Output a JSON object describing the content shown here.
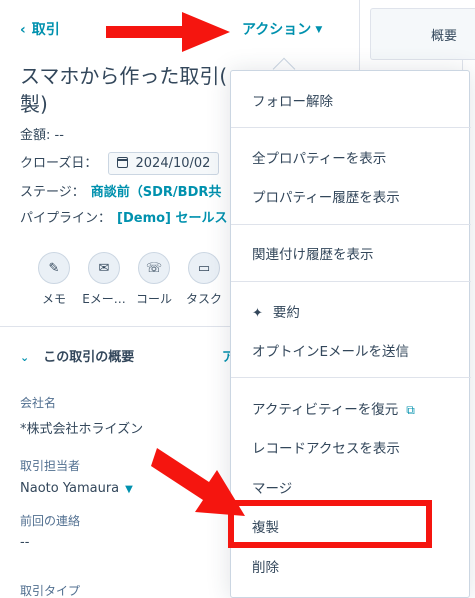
{
  "header": {
    "back_label": "取引",
    "actions_label": "アクション"
  },
  "record": {
    "title_line1": "スマホから作った取引(",
    "title_line2": "製)",
    "amount_label": "金額: --",
    "close_label": "クローズ日：",
    "close_date": "2024/10/02",
    "stage_label": "ステージ：",
    "stage_value": "商談前（SDR/BDR共",
    "pipeline_label": "パイプライン：",
    "pipeline_value": "[Demo] セールス"
  },
  "activity_buttons": [
    {
      "label": "メモ",
      "icon": "pencil-icon"
    },
    {
      "label": "Eメー…",
      "icon": "mail-icon"
    },
    {
      "label": "コール",
      "icon": "phone-icon"
    },
    {
      "label": "タスク",
      "icon": "task-icon"
    }
  ],
  "summary": {
    "section_title": "この取引の概要",
    "section_right": "ア",
    "company_label": "会社名",
    "company_value": "*株式会社ホライズン",
    "owner_label": "取引担当者",
    "owner_value": "Naoto Yamaura",
    "last_contact_label": "前回の連絡",
    "last_contact_value": "--",
    "deal_type_label": "取引タイプ"
  },
  "right_tab": {
    "label": "概要"
  },
  "menu": {
    "items": [
      "フォロー解除",
      "全プロパティーを表示",
      "プロパティー履歴を表示",
      "関連付け履歴を表示",
      "要約",
      "オプトインEメールを送信",
      "アクティビティーを復元",
      "レコードアクセスを表示",
      "マージ",
      "複製",
      "削除"
    ]
  },
  "colors": {
    "accent": "#0091ae",
    "text": "#33475b",
    "annotation": "#f5150f"
  }
}
